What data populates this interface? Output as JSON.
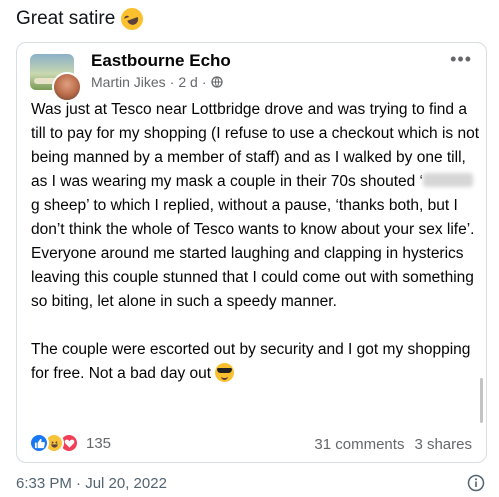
{
  "tweet": {
    "text": "Great satire",
    "emoji": "rolling-on-floor-laughing",
    "timestamp": "6:33 PM · Jul 20, 2022"
  },
  "post": {
    "page_name": "Eastbourne Echo",
    "author": "Martin Jikes",
    "age": "2 d",
    "separator": "·",
    "paragraph1_before_blur": "Was just at Tesco near Lottbridge drove and was trying to find a till to pay for my shopping (I refuse to use a checkout which is not being manned by a member of staff) and as I walked by one till, as I was wearing my mask a couple in their 70s shouted ‘",
    "paragraph1_after_blur": "g sheep’ to which I replied, without a pause, ‘thanks both, but I don’t think the whole of Tesco wants to know about your sex life’. Everyone around me started laughing and clapping in hysterics leaving this couple stunned that I could come out with something so biting, let alone in such a speedy manner.",
    "paragraph2": "The couple were escorted out by security and I got my shopping for free. Not a bad day out",
    "reaction_count": "135",
    "comments": "31 comments",
    "shares": "3 shares"
  },
  "icons": {
    "more": "more-options-icon",
    "globe": "globe-icon",
    "info": "info-icon",
    "reactions": [
      "like-icon",
      "haha-icon",
      "love-icon"
    ]
  },
  "colors": {
    "facebook_blue": "#1877f2",
    "love_red": "#f33e58",
    "haha_yellow": "#f7c33b",
    "meta_gray": "#65676b"
  }
}
